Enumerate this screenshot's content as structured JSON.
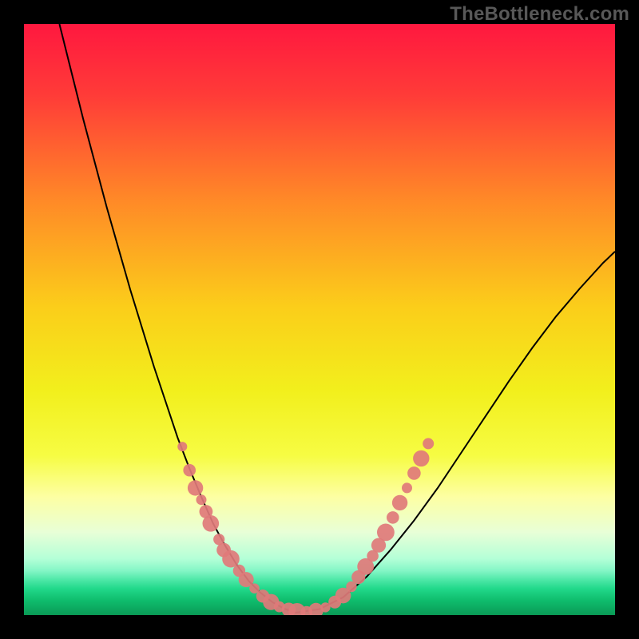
{
  "watermark": "TheBottleneck.com",
  "chart_data": {
    "type": "line",
    "title": "",
    "xlabel": "",
    "ylabel": "",
    "xlim": [
      0,
      1
    ],
    "ylim": [
      0,
      1
    ],
    "background_gradient": {
      "stops": [
        {
          "offset": 0.0,
          "color": "#ff183f"
        },
        {
          "offset": 0.12,
          "color": "#ff3b38"
        },
        {
          "offset": 0.3,
          "color": "#ff8a27"
        },
        {
          "offset": 0.48,
          "color": "#fbce1a"
        },
        {
          "offset": 0.62,
          "color": "#f2ef1c"
        },
        {
          "offset": 0.73,
          "color": "#f6fc43"
        },
        {
          "offset": 0.8,
          "color": "#fdffa3"
        },
        {
          "offset": 0.86,
          "color": "#e8ffd7"
        },
        {
          "offset": 0.905,
          "color": "#b3ffd7"
        },
        {
          "offset": 0.925,
          "color": "#84f6c6"
        },
        {
          "offset": 0.94,
          "color": "#4fe8a8"
        },
        {
          "offset": 0.955,
          "color": "#22d98b"
        },
        {
          "offset": 0.975,
          "color": "#0fbd6d"
        },
        {
          "offset": 1.0,
          "color": "#0a9a56"
        }
      ]
    },
    "series": [
      {
        "name": "bottleneck-curve",
        "color": "#000000",
        "width": 2,
        "x": [
          0.06,
          0.08,
          0.1,
          0.12,
          0.14,
          0.16,
          0.18,
          0.2,
          0.22,
          0.24,
          0.26,
          0.28,
          0.3,
          0.32,
          0.34,
          0.36,
          0.38,
          0.4,
          0.42,
          0.44,
          0.46,
          0.5,
          0.54,
          0.58,
          0.62,
          0.66,
          0.7,
          0.74,
          0.78,
          0.82,
          0.86,
          0.9,
          0.94,
          0.98,
          1.0
        ],
        "y": [
          1.0,
          0.92,
          0.84,
          0.765,
          0.69,
          0.62,
          0.55,
          0.485,
          0.42,
          0.36,
          0.3,
          0.248,
          0.2,
          0.155,
          0.118,
          0.085,
          0.058,
          0.038,
          0.022,
          0.011,
          0.004,
          0.01,
          0.03,
          0.065,
          0.11,
          0.16,
          0.215,
          0.275,
          0.335,
          0.395,
          0.452,
          0.505,
          0.552,
          0.596,
          0.615
        ]
      }
    ],
    "dot_overlay": {
      "color": "#e07a7a",
      "radius_range": [
        6,
        11
      ],
      "points": [
        {
          "x": 0.268,
          "y": 0.285
        },
        {
          "x": 0.28,
          "y": 0.245
        },
        {
          "x": 0.29,
          "y": 0.215
        },
        {
          "x": 0.3,
          "y": 0.195
        },
        {
          "x": 0.308,
          "y": 0.175
        },
        {
          "x": 0.316,
          "y": 0.155
        },
        {
          "x": 0.33,
          "y": 0.128
        },
        {
          "x": 0.338,
          "y": 0.11
        },
        {
          "x": 0.35,
          "y": 0.095
        },
        {
          "x": 0.364,
          "y": 0.075
        },
        {
          "x": 0.376,
          "y": 0.06
        },
        {
          "x": 0.39,
          "y": 0.045
        },
        {
          "x": 0.404,
          "y": 0.032
        },
        {
          "x": 0.418,
          "y": 0.022
        },
        {
          "x": 0.432,
          "y": 0.014
        },
        {
          "x": 0.448,
          "y": 0.009
        },
        {
          "x": 0.462,
          "y": 0.006
        },
        {
          "x": 0.478,
          "y": 0.005
        },
        {
          "x": 0.494,
          "y": 0.008
        },
        {
          "x": 0.51,
          "y": 0.013
        },
        {
          "x": 0.526,
          "y": 0.022
        },
        {
          "x": 0.54,
          "y": 0.033
        },
        {
          "x": 0.554,
          "y": 0.048
        },
        {
          "x": 0.566,
          "y": 0.064
        },
        {
          "x": 0.578,
          "y": 0.082
        },
        {
          "x": 0.59,
          "y": 0.1
        },
        {
          "x": 0.6,
          "y": 0.118
        },
        {
          "x": 0.612,
          "y": 0.14
        },
        {
          "x": 0.624,
          "y": 0.165
        },
        {
          "x": 0.636,
          "y": 0.19
        },
        {
          "x": 0.648,
          "y": 0.215
        },
        {
          "x": 0.66,
          "y": 0.24
        },
        {
          "x": 0.672,
          "y": 0.265
        },
        {
          "x": 0.684,
          "y": 0.29
        }
      ]
    }
  }
}
